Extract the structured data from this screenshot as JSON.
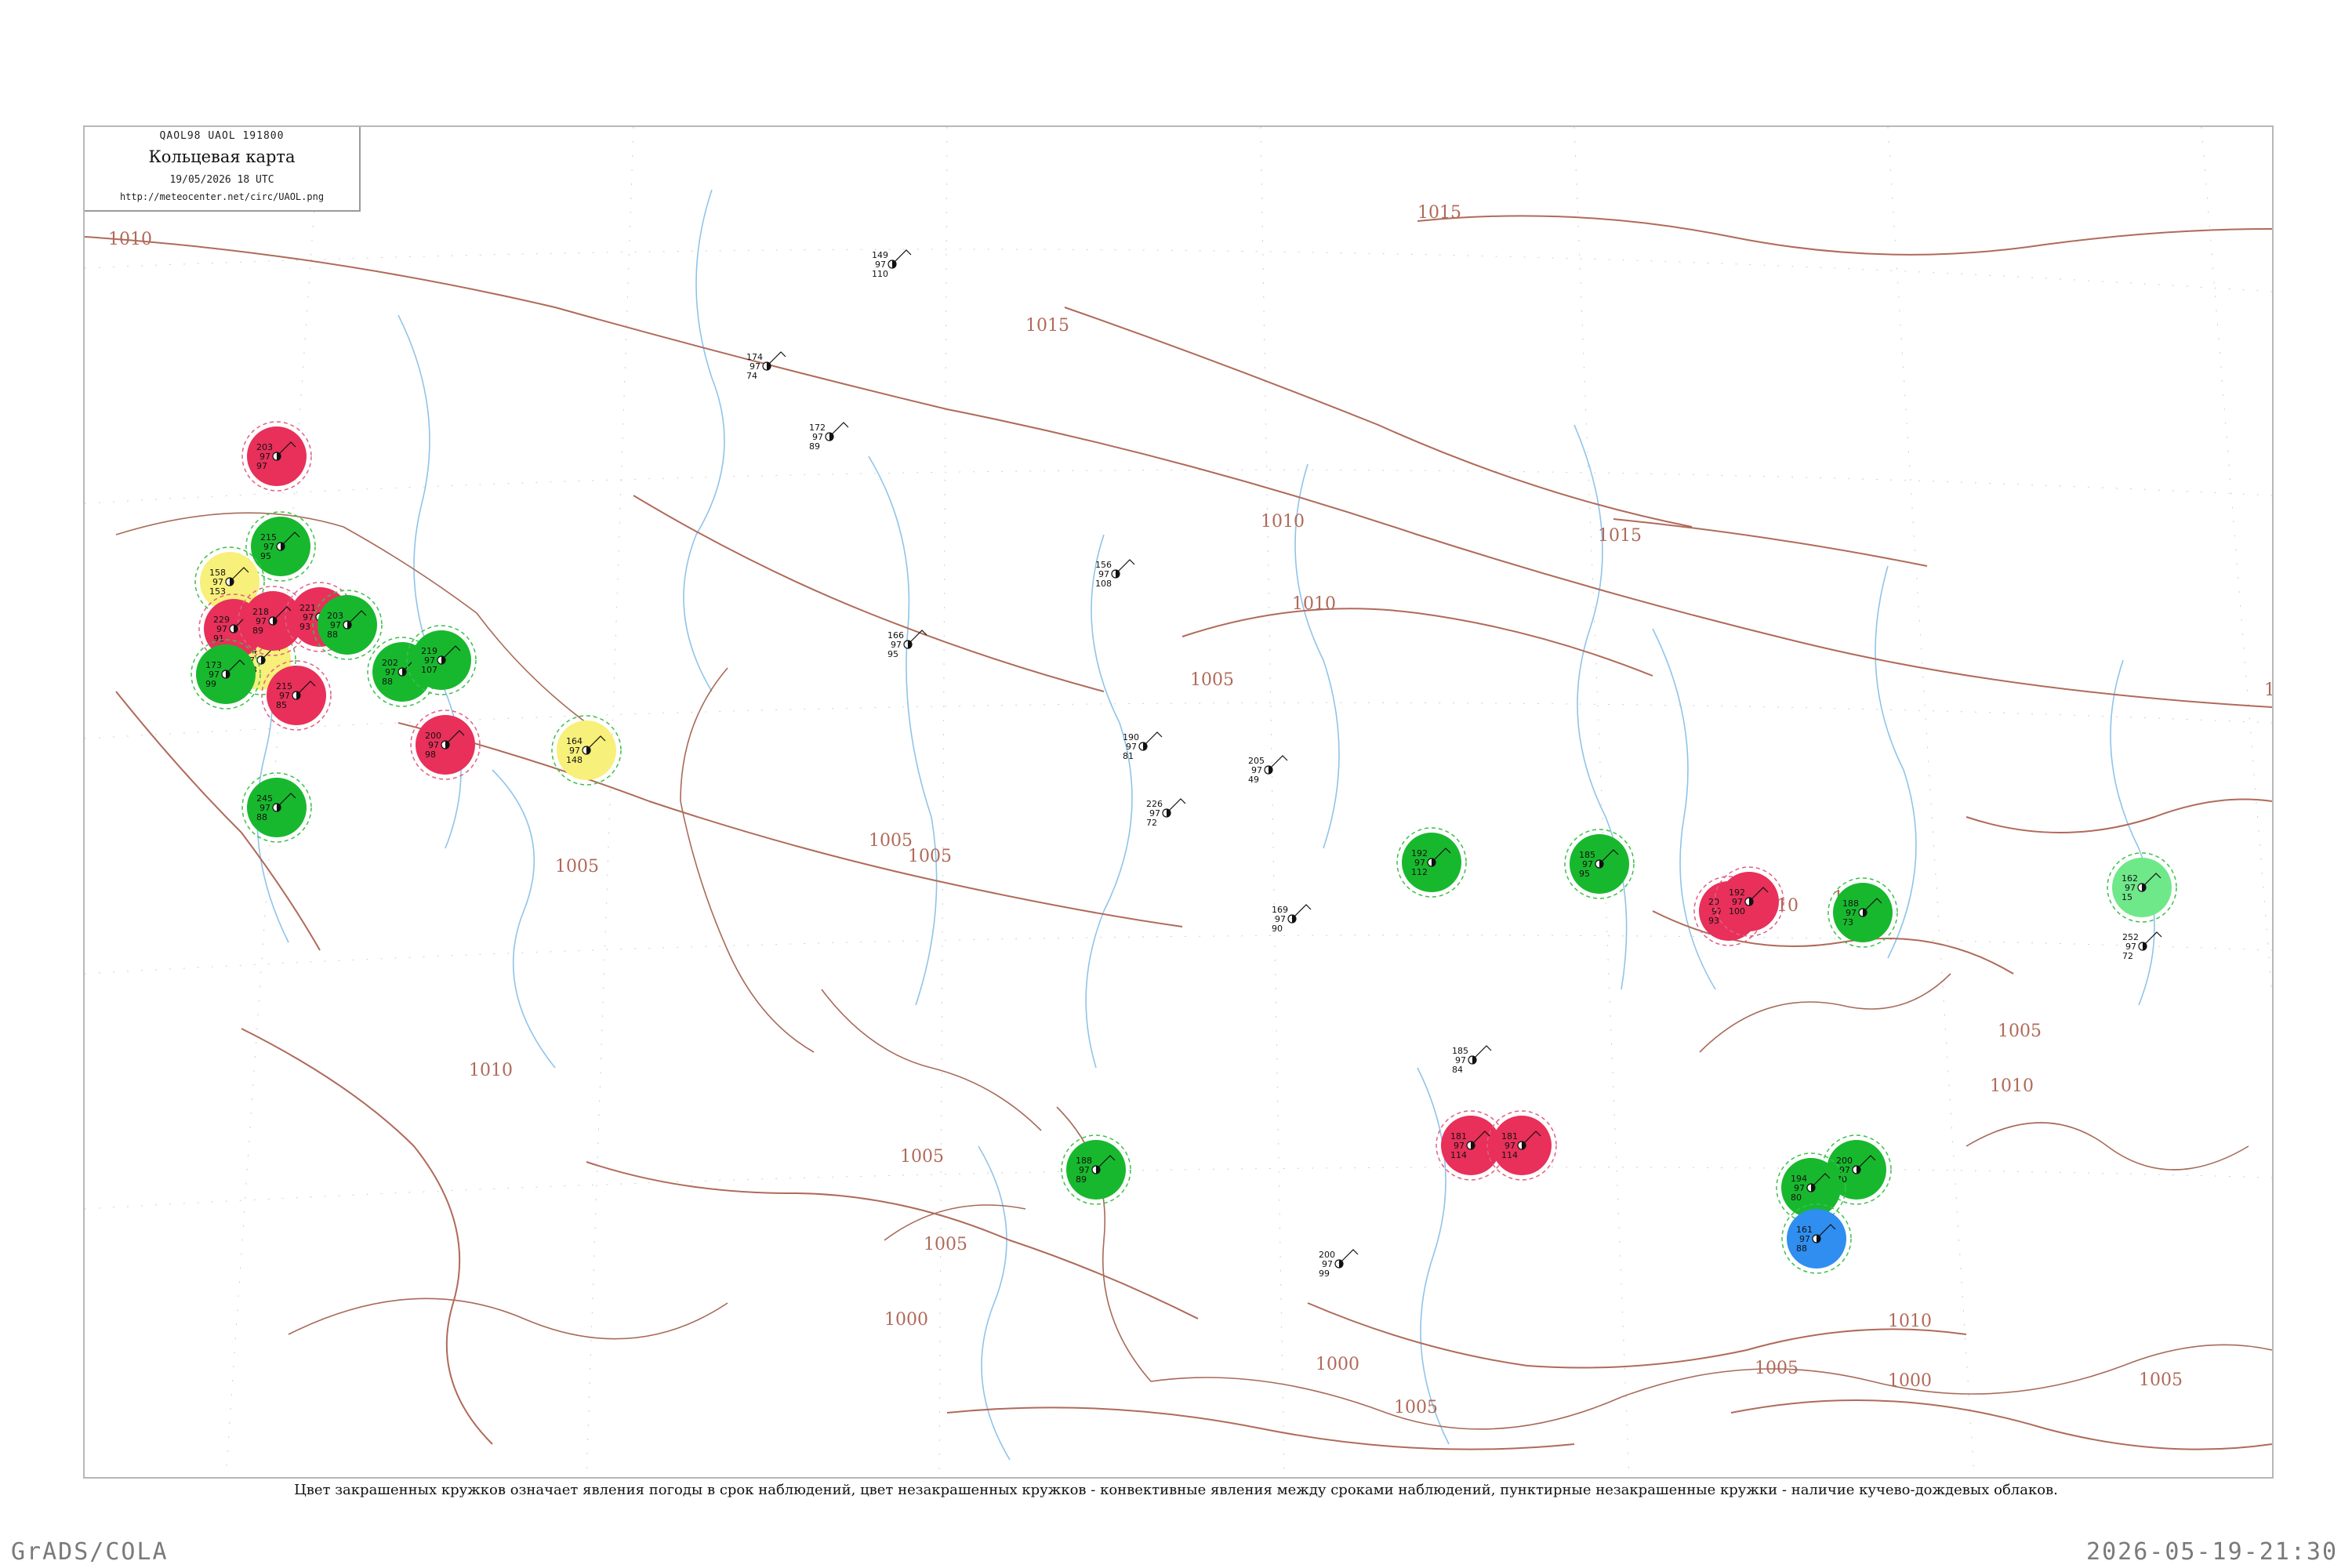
{
  "legend": {
    "code_line": "QAOL98  UAOL  191800",
    "title": "Кольцевая карта",
    "datetime": "19/05/2026 18 UTC",
    "url": "http://meteocenter.net/circ/UAOL.png"
  },
  "caption": "Цвет закрашенных кружков означает явления погоды в срок наблюдений, цвет незакрашенных кружков - конвективные явления между сроками наблюдений, пунктирные незакрашенные кружки - наличие кучево-дождевых облаков.",
  "footer": {
    "left": "GrADS/COLA",
    "right": "2026-05-19-21:30"
  },
  "colors": {
    "isobar": "#b06a5a",
    "river": "#8fc4ea",
    "fill_red": "#e8305a",
    "fill_green": "#18b82e",
    "fill_yellow": "#f7f07a",
    "fill_blue": "#2f8ef0",
    "fill_lightgreen": "#6fe88a",
    "dashed_green": "#3cc04a",
    "dashed_red": "#e06080"
  },
  "isobar_labels": [
    "1010",
    "1015",
    "1015",
    "1010",
    "1015",
    "1010",
    "1005",
    "1005",
    "1005",
    "1010",
    "1010",
    "1005",
    "1005",
    "1005",
    "1005",
    "1010",
    "1005",
    "1000",
    "1000",
    "1005",
    "1005",
    "1000",
    "1005",
    "1010",
    "1010"
  ],
  "stations": [
    {
      "id": "34163",
      "p": "203",
      "t": "97",
      "d": "97",
      "marker": "filled-red"
    },
    {
      "id": "34172",
      "p": "215",
      "t": "97",
      "d": "95",
      "marker": "filled-green"
    },
    {
      "id": "34139",
      "p": "158",
      "t": "97",
      "d": "153",
      "marker": "filled-yellow"
    },
    {
      "id": "34240",
      "p": "194",
      "t": "97",
      "d": "153",
      "marker": "filled-yellow"
    },
    {
      "id": "35121",
      "p": "164",
      "t": "97",
      "d": "148",
      "marker": "filled-yellow"
    },
    {
      "id": "34146",
      "p": "229",
      "t": "97",
      "d": "91",
      "marker": "filled-red"
    },
    {
      "id": "34152",
      "p": "218",
      "t": "97",
      "d": "89",
      "marker": "filled-red"
    },
    {
      "id": "34160",
      "p": "221",
      "t": "97",
      "d": "93",
      "marker": "filled-red"
    },
    {
      "id": "34163b",
      "p": "203",
      "t": "97",
      "d": "88",
      "marker": "filled-green"
    },
    {
      "id": "34247",
      "p": "202",
      "t": "97",
      "d": "88",
      "marker": "filled-green"
    },
    {
      "id": "34321",
      "p": "215",
      "t": "97",
      "d": "85",
      "marker": "filled-red"
    },
    {
      "id": "34336",
      "p": "219",
      "t": "97",
      "d": "107",
      "marker": "filled-green"
    },
    {
      "id": "34432",
      "p": "200",
      "t": "97",
      "d": "98",
      "marker": "filled-red"
    },
    {
      "id": "35011",
      "p": "173",
      "t": "97",
      "d": "99",
      "marker": "filled-green"
    },
    {
      "id": "34559",
      "p": "245",
      "t": "97",
      "d": "88",
      "marker": "filled-green"
    },
    {
      "id": "36034",
      "p": "192",
      "t": "97",
      "d": "112",
      "marker": "filled-green"
    },
    {
      "id": "36177",
      "p": "181",
      "t": "97",
      "d": "114",
      "marker": "filled-red"
    },
    {
      "id": "36229",
      "p": "181",
      "t": "97",
      "d": "114",
      "marker": "filled-red"
    },
    {
      "id": "38911",
      "p": "185",
      "t": "97",
      "d": "95",
      "marker": "filled-green"
    },
    {
      "id": "38927",
      "p": "205",
      "t": "97",
      "d": "93",
      "marker": "filled-red"
    },
    {
      "id": "38932",
      "p": "192",
      "t": "97",
      "d": "100",
      "marker": "filled-red"
    },
    {
      "id": "35078",
      "p": "188",
      "t": "97",
      "d": "73",
      "marker": "filled-green"
    },
    {
      "id": "38836",
      "p": "200",
      "t": "97",
      "d": "70",
      "marker": "filled-green"
    },
    {
      "id": "38599",
      "p": "188",
      "t": "97",
      "d": "89",
      "marker": "filled-green"
    },
    {
      "id": "38615",
      "p": "194",
      "t": "97",
      "d": "80",
      "marker": "filled-green"
    },
    {
      "id": "36259",
      "p": "161",
      "t": "97",
      "d": "88",
      "marker": "filled-blue"
    },
    {
      "id": "36329",
      "p": "162",
      "t": "97",
      "d": "15",
      "marker": "filled-lightgreen"
    },
    {
      "id": "34123",
      "p": "252",
      "t": "97",
      "d": "72",
      "marker": "plain"
    },
    {
      "id": "34131",
      "p": "174",
      "t": "97",
      "d": "74",
      "marker": "plain"
    },
    {
      "id": "35229",
      "p": "149",
      "t": "97",
      "d": "110",
      "marker": "plain"
    },
    {
      "id": "35394",
      "p": "172",
      "t": "97",
      "d": "89",
      "marker": "plain"
    },
    {
      "id": "35700",
      "p": "166",
      "t": "97",
      "d": "95",
      "marker": "plain"
    },
    {
      "id": "36003",
      "p": "156",
      "t": "97",
      "d": "108",
      "marker": "plain"
    },
    {
      "id": "36096",
      "p": "169",
      "t": "97",
      "d": "90",
      "marker": "plain"
    },
    {
      "id": "36177b",
      "p": "185",
      "t": "97",
      "d": "84",
      "marker": "plain"
    },
    {
      "id": "37470",
      "p": "226",
      "t": "97",
      "d": "72",
      "marker": "plain"
    },
    {
      "id": "38341",
      "p": "205",
      "t": "97",
      "d": "49",
      "marker": "plain"
    },
    {
      "id": "38413",
      "p": "190",
      "t": "97",
      "d": "81",
      "marker": "plain"
    },
    {
      "id": "38618",
      "p": "200",
      "t": "97",
      "d": "99",
      "marker": "plain"
    }
  ]
}
